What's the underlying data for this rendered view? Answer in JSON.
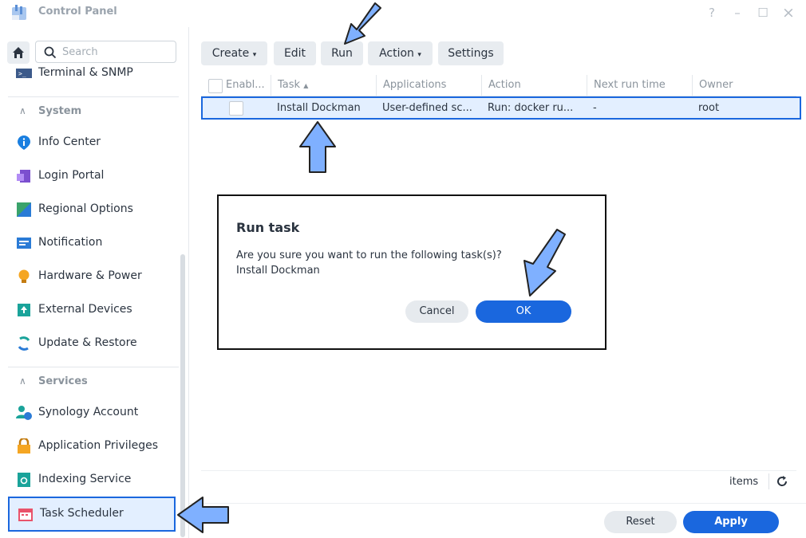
{
  "window": {
    "title": "Control Panel",
    "help": "?",
    "minimize": "–",
    "maximize": "☐",
    "close": "×"
  },
  "sidebar": {
    "search_placeholder": "Search",
    "partial_item": "Terminal & SNMP",
    "sections": [
      {
        "label": "System",
        "items": [
          "Info Center",
          "Login Portal",
          "Regional Options",
          "Notification",
          "Hardware & Power",
          "External Devices",
          "Update & Restore"
        ]
      },
      {
        "label": "Services",
        "items": [
          "Synology Account",
          "Application Privileges",
          "Indexing Service",
          "Task Scheduler"
        ]
      }
    ],
    "active_item": "Task Scheduler"
  },
  "toolbar": {
    "create": "Create",
    "edit": "Edit",
    "run": "Run",
    "action": "Action",
    "settings": "Settings"
  },
  "grid": {
    "columns": [
      "Enabl...",
      "Task",
      "Applications",
      "Action",
      "Next run time",
      "Owner"
    ],
    "rows": [
      {
        "task": "Install Dockman",
        "applications": "User-defined sc...",
        "action": "Run: docker ru...",
        "next_run": "-",
        "owner": "root"
      }
    ]
  },
  "footer": {
    "items_label": "items",
    "reset": "Reset",
    "apply": "Apply"
  },
  "dialog": {
    "title": "Run task",
    "message": "Are you sure you want to run the following task(s)?",
    "task_name": "Install Dockman",
    "cancel": "Cancel",
    "ok": "OK"
  },
  "colors": {
    "accent": "#1a67de",
    "arrow_fill": "#7fb0ff",
    "selection": "#e3efff"
  }
}
